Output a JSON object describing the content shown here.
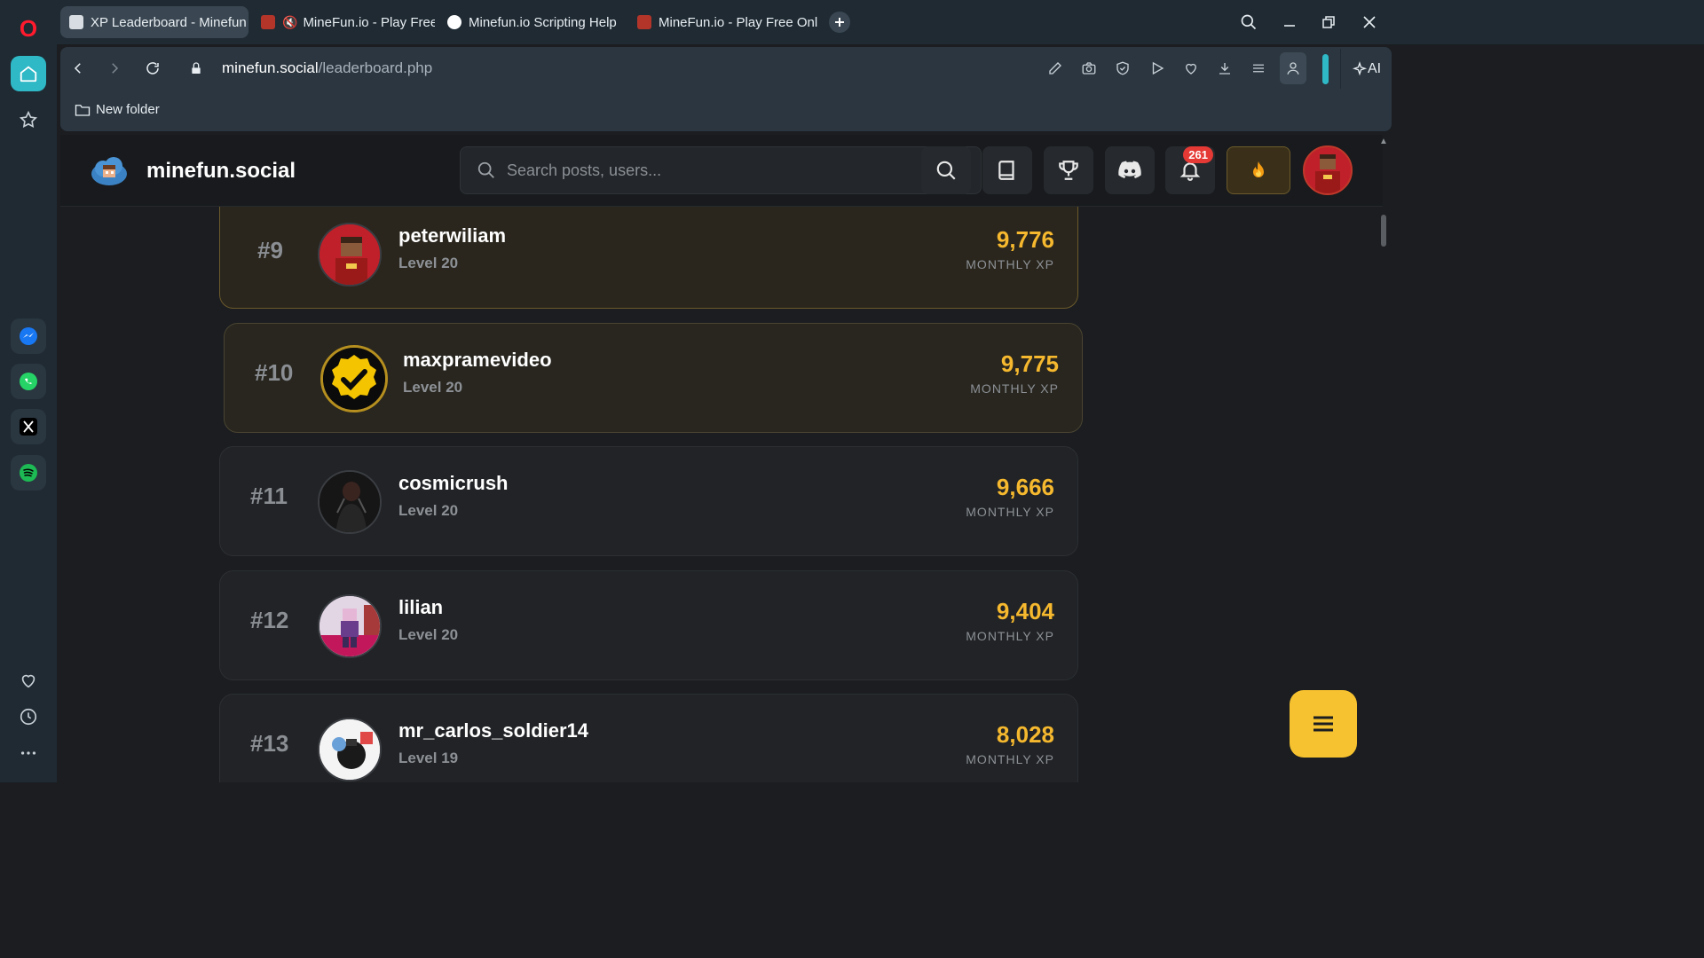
{
  "browser": {
    "tabs": [
      {
        "label": "XP Leaderboard - Minefun",
        "active": true
      },
      {
        "label": "MineFun.io - Play Free",
        "active": false,
        "muted": true
      },
      {
        "label": "Minefun.io Scripting Help",
        "active": false
      },
      {
        "label": "MineFun.io - Play Free Onl",
        "active": false
      }
    ],
    "url_host": "minefun.social",
    "url_path": "/leaderboard.php",
    "ai_label": "AI",
    "bookmark": "New folder"
  },
  "site": {
    "name": "minefun.social",
    "search_placeholder": "Search posts, users...",
    "notification_count": "261"
  },
  "leaderboard": [
    {
      "rank": "#9",
      "username": "peterwiliam",
      "level": "Level 20",
      "xp": "9,776",
      "xp_label": "MONTHLY XP"
    },
    {
      "rank": "#10",
      "username": "maxpramevideo",
      "level": "Level 20",
      "xp": "9,775",
      "xp_label": "MONTHLY XP"
    },
    {
      "rank": "#11",
      "username": "cosmicrush",
      "level": "Level 20",
      "xp": "9,666",
      "xp_label": "MONTHLY XP"
    },
    {
      "rank": "#12",
      "username": "lilian",
      "level": "Level 20",
      "xp": "9,404",
      "xp_label": "MONTHLY XP"
    },
    {
      "rank": "#13",
      "username": "mr_carlos_soldier14",
      "level": "Level 19",
      "xp": "8,028",
      "xp_label": "MONTHLY XP"
    }
  ],
  "colors": {
    "accent": "#f5b82e",
    "opera_red": "#ff1b2d",
    "sidebar_active": "#2fb8c6",
    "badge": "#e53935"
  }
}
